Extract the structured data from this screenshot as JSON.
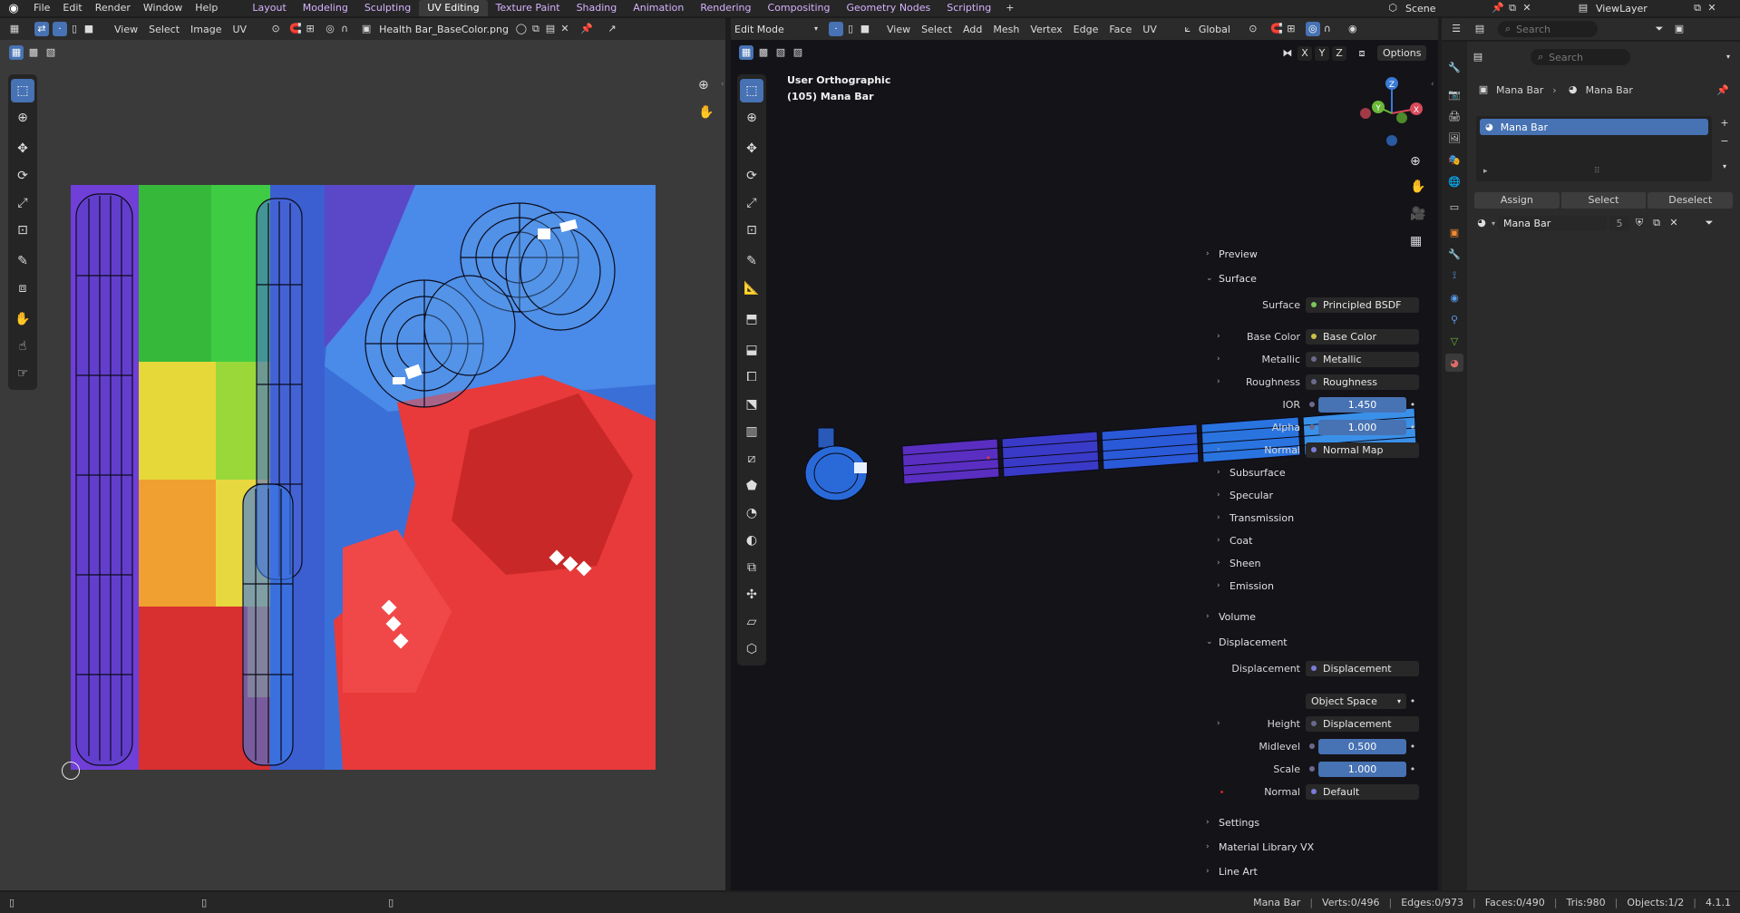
{
  "topbar": {
    "menus": [
      "File",
      "Edit",
      "Render",
      "Window",
      "Help"
    ],
    "workspaces": [
      "Layout",
      "Modeling",
      "Sculpting",
      "UV Editing",
      "Texture Paint",
      "Shading",
      "Animation",
      "Rendering",
      "Compositing",
      "Geometry Nodes",
      "Scripting"
    ],
    "active_workspace": "UV Editing",
    "add_tab": "+",
    "scene_label": "Scene",
    "viewlayer_label": "ViewLayer"
  },
  "uv_editor": {
    "menus": [
      "View",
      "Select",
      "Image",
      "UV"
    ],
    "image_name": "Health Bar_BaseColor.png"
  },
  "viewport": {
    "mode": "Edit Mode",
    "menus": [
      "View",
      "Select",
      "Add",
      "Mesh",
      "Vertex",
      "Edge",
      "Face",
      "UV"
    ],
    "transform_orientation": "Global",
    "view_name": "User Orthographic",
    "object_label": "(105) Mana Bar",
    "axes_buttons": [
      "X",
      "Y",
      "Z"
    ],
    "options_label": "Options",
    "gizmo": {
      "x": "X",
      "y": "Y",
      "z": "Z"
    }
  },
  "outliner": {
    "search_placeholder": "Search"
  },
  "properties": {
    "search_placeholder": "Search",
    "breadcrumb_object": "Mana Bar",
    "breadcrumb_material": "Mana Bar",
    "slot_name": "Mana Bar",
    "assign_label": "Assign",
    "select_label": "Select",
    "deselect_label": "Deselect",
    "material_name": "Mana Bar",
    "user_count": "5",
    "sections": {
      "preview": "Preview",
      "surface": "Surface",
      "subsurface": "Subsurface",
      "specular": "Specular",
      "transmission": "Transmission",
      "coat": "Coat",
      "sheen": "Sheen",
      "emission": "Emission",
      "volume": "Volume",
      "displacement": "Displacement",
      "settings": "Settings",
      "material_library": "Material Library VX",
      "line_art": "Line Art"
    },
    "surface_rows": [
      {
        "label": "Surface",
        "value": "Principled BSDF"
      },
      {
        "label": "Base Color",
        "value": "Base Color"
      },
      {
        "label": "Metallic",
        "value": "Metallic"
      },
      {
        "label": "Roughness",
        "value": "Roughness"
      },
      {
        "label": "IOR",
        "value": "1.450"
      },
      {
        "label": "Alpha",
        "value": "1.000"
      },
      {
        "label": "Normal",
        "value": "Normal Map"
      }
    ],
    "displacement_rows": [
      {
        "label": "Displacement",
        "value": "Displacement"
      },
      {
        "label": "",
        "value": "Object Space"
      },
      {
        "label": "Height",
        "value": "Displacement"
      },
      {
        "label": "Midlevel",
        "value": "0.500"
      },
      {
        "label": "Scale",
        "value": "1.000"
      },
      {
        "label": "Normal",
        "value": "Default"
      }
    ]
  },
  "statusbar": {
    "object": "Mana Bar",
    "verts": "Verts:0/496",
    "edges": "Edges:0/973",
    "faces": "Faces:0/490",
    "tris": "Tris:980",
    "objects": "Objects:1/2",
    "version": "4.1.1"
  },
  "colors": {
    "accent": "#4772b3",
    "bg": "#1d1d1d",
    "panel": "#303030"
  }
}
